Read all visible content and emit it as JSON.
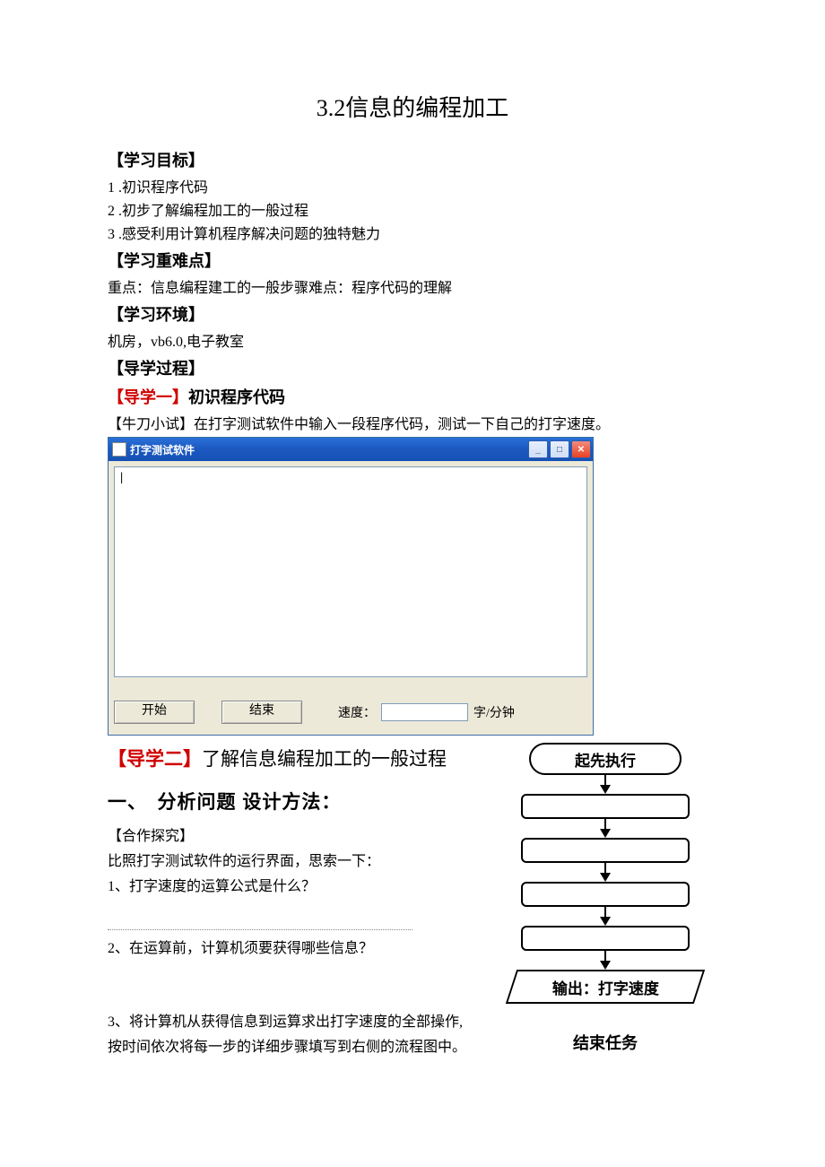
{
  "title": "3.2信息的编程加工",
  "sections": {
    "objectives": {
      "heading": "【学习目标】",
      "items": [
        "1 .初识程序代码",
        "2 .初步了解编程加工的一般过程",
        "3 .感受利用计算机程序解决问题的独特魅力"
      ]
    },
    "key_points": {
      "heading": "【学习重难点】",
      "text": "重点：信息编程建工的一般步骤难点：程序代码的理解"
    },
    "environment": {
      "heading": "【学习环境】",
      "text": "机房，vb6.0,电子教室"
    },
    "process": {
      "heading": "【导学过程】"
    },
    "guide1": {
      "bracket": "【导学一】",
      "rest": "初识程序代码",
      "tryout": "【牛刀小试】在打字测试软件中输入一段程序代码，测试一下自己的打字速度。"
    },
    "guide2": {
      "bracket": "【导学二】",
      "rest": "了解信息编程加工的一般过程"
    }
  },
  "typing_window": {
    "title": "打字测试软件",
    "text_content": "|",
    "start_btn": "开始",
    "end_btn": "结束",
    "speed_label": "速度：",
    "speed_unit": "字/分钟"
  },
  "analysis": {
    "h2": "一、　分析问题 设计方法：",
    "coop": "【合作探究】",
    "line_intro": "比照打字测试软件的运行界面，思索一下：",
    "q1": "1、打字速度的运算公式是什么？",
    "q2": "2、在运算前，计算机须要获得哪些信息？",
    "q3a": "3、将计算机从获得信息到运算求出打字速度的全部操作,",
    "q3b": "按时间依次将每一步的详细步骤填写到右侧的流程图中。"
  },
  "flowchart": {
    "start": "起先执行",
    "output": "输出：打字速度",
    "end": "结束任务"
  }
}
